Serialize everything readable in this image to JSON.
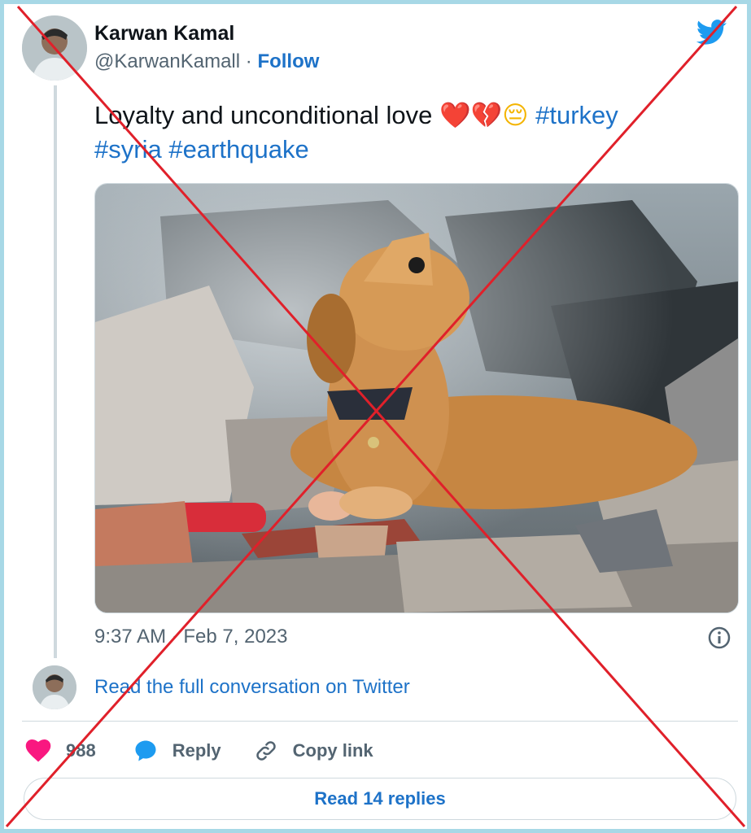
{
  "author": {
    "name": "Karwan Kamal",
    "handle": "@KarwanKamall",
    "separator": " · ",
    "follow_label": "Follow"
  },
  "tweet": {
    "text": "Loyalty and unconditional love ",
    "emojis": [
      "❤️",
      "💔",
      "😔"
    ],
    "hashtags": [
      "#turkey",
      "#syria",
      "#earthquake"
    ],
    "timestamp": "9:37 AM · Feb 7, 2023"
  },
  "conversation": {
    "read_full_label": "Read the full conversation on Twitter"
  },
  "actions": {
    "likes_count": "988",
    "reply_label": "Reply",
    "copy_link_label": "Copy link"
  },
  "replies_button": "Read 14 replies",
  "colors": {
    "link": "#1d72c8",
    "like": "#f91880",
    "frame": "#a7d8e6",
    "cross": "#e0202a"
  },
  "icons": [
    "twitter-bird-icon",
    "info-icon",
    "heart-icon",
    "reply-bubble-icon",
    "link-icon"
  ]
}
